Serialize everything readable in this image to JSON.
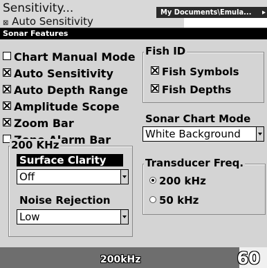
{
  "background": {
    "menu_item_1": "Sensitivity...",
    "menu_item_2": "Auto Sensitivity",
    "path": "My Documents\\Emula...",
    "arrow": "▸"
  },
  "dialog": {
    "title": "Sonar Features",
    "checkboxes": [
      {
        "label": "Chart Manual Mode",
        "checked": false
      },
      {
        "label": "Auto Sensitivity",
        "checked": true
      },
      {
        "label": "Auto Depth Range",
        "checked": true
      },
      {
        "label": "Amplitude Scope",
        "checked": true
      },
      {
        "label": "Zoom Bar",
        "checked": true
      },
      {
        "label": "Zone Alarm Bar",
        "checked": false
      }
    ],
    "fish_id": {
      "title": "Fish ID",
      "fish_symbols": "Fish Symbols",
      "fish_depths": "Fish Depths"
    },
    "sonar_chart_mode": {
      "label": "Sonar Chart Mode",
      "value": "White Background"
    },
    "khz_group": {
      "title": "200 KHz",
      "surface_clarity_label": "Surface Clarity",
      "surface_clarity_value": "Off",
      "noise_rejection_label": "Noise Rejection",
      "noise_rejection_value": "Low"
    },
    "transducer": {
      "title": "Transducer Freq.",
      "options": [
        {
          "label": "200 kHz",
          "selected": true
        },
        {
          "label": "50 kHz",
          "selected": false
        }
      ]
    }
  },
  "status": {
    "frequency": "200kHz",
    "depth": "60"
  }
}
